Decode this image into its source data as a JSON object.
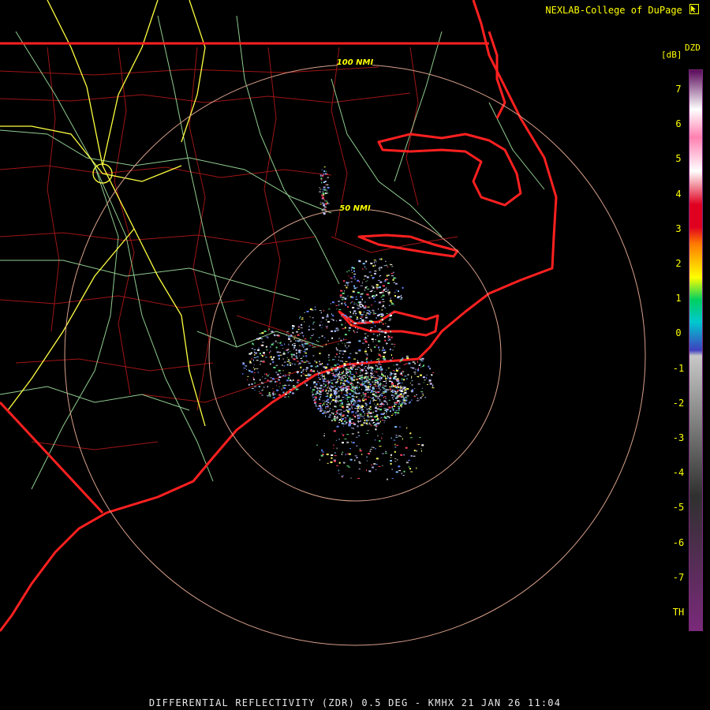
{
  "credit": "NEXLAB-College of DuPage",
  "credit_icon": "cursor-arrow-icon",
  "product_label": "DZD",
  "unit_label": "[dB]",
  "range_rings": [
    "100 NMI",
    "50 NMI"
  ],
  "legend": {
    "ticks": [
      "7",
      "6",
      "5",
      "4",
      "3",
      "2",
      "1",
      "0",
      "-1",
      "-2",
      "-3",
      "-4",
      "-5",
      "-6",
      "-7",
      "TH"
    ],
    "colors": {
      "top": "#5a0a5a",
      "high": "#ffffff",
      "pink": "#ff80b0",
      "red": "#e00020",
      "orange": "#ff7a00",
      "yellow": "#ffff00",
      "green": "#00d060",
      "cyan": "#00c8d0",
      "blue": "#4040c0",
      "gray": "#c8c8c8",
      "dark": "#303030",
      "low": "#7a2a7a"
    }
  },
  "map_colors": {
    "state_border": "#ff2020",
    "county_line": "#b01818",
    "highway": "#ffff40",
    "road": "#a8f0a8",
    "range_ring": "#d8a08a"
  },
  "footer": "DIFFERENTIAL REFLECTIVITY (ZDR) 0.5 DEG - KMHX 21 JAN 26 11:04"
}
